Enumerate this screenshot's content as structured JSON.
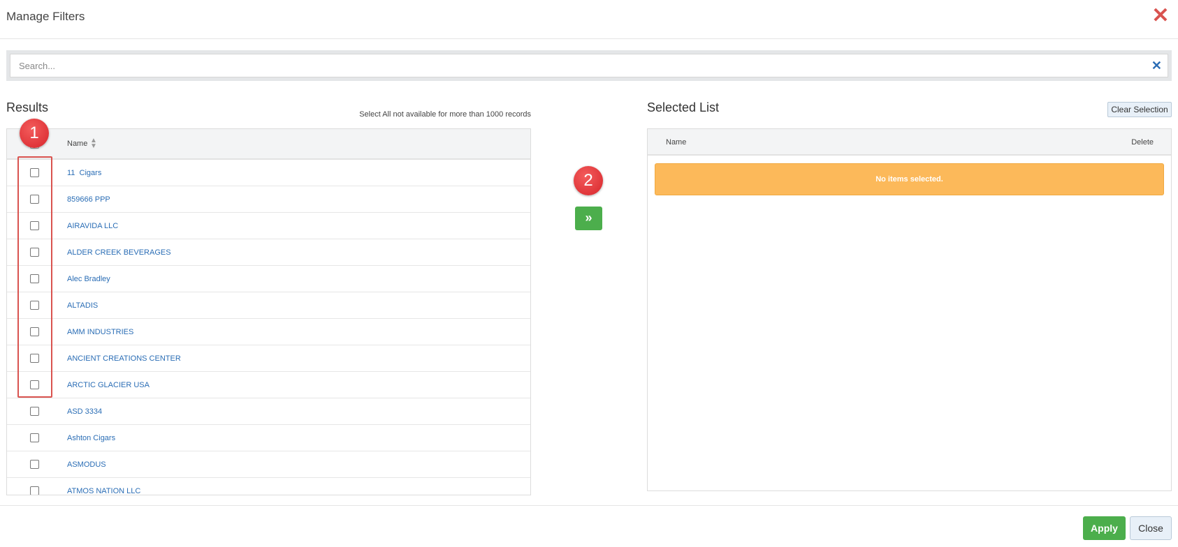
{
  "dialog": {
    "title": "Manage Filters",
    "close_icon": "close-icon",
    "accent_color": "#d9534f"
  },
  "search": {
    "placeholder": "Search...",
    "value": "",
    "clear_icon": "clear-icon"
  },
  "results": {
    "title": "Results",
    "note": "Select All not available for more than 1000 records",
    "column_name": "Name",
    "sort_icon": "sort-icon",
    "rows": [
      "11  Cigars",
      "859666 PPP",
      "AIRAVIDA LLC",
      "ALDER CREEK BEVERAGES",
      "Alec Bradley",
      "ALTADIS",
      "AMM INDUSTRIES",
      "ANCIENT CREATIONS CENTER",
      "ARCTIC GLACIER USA",
      "ASD 3334",
      "Ashton Cigars",
      "ASMODUS",
      "ATMOS NATION LLC"
    ]
  },
  "annotations": {
    "badge1": "1",
    "badge2": "2"
  },
  "move_button": {
    "icon": "double-chevron-right-icon",
    "glyph": "»"
  },
  "selected": {
    "title": "Selected List",
    "clear_label": "Clear Selection",
    "column_name": "Name",
    "column_delete": "Delete",
    "empty_message": "No items selected."
  },
  "footer": {
    "apply_label": "Apply",
    "close_label": "Close",
    "apply_color": "#4cae4c"
  }
}
